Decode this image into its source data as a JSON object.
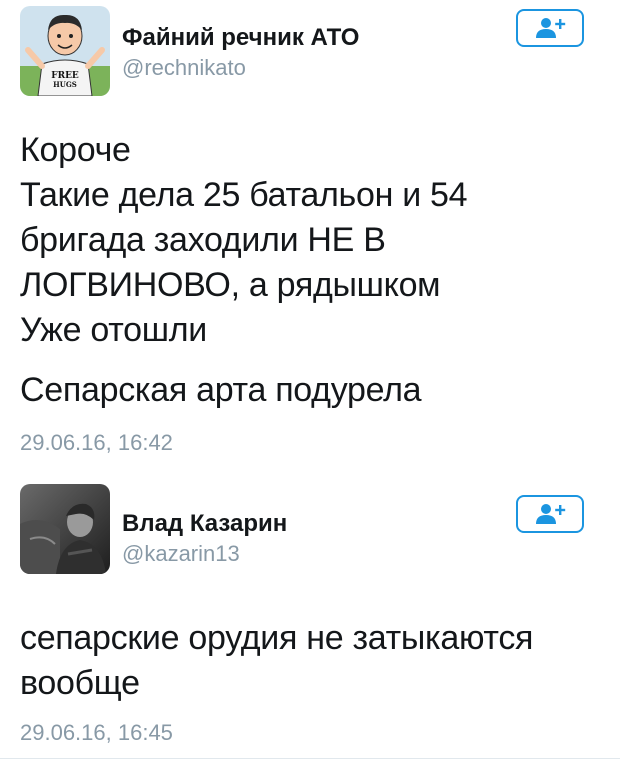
{
  "tweets": [
    {
      "author_name": "Файний речник АТО",
      "handle": "@rechnikato",
      "avatar_text": [
        "FREE",
        "HUGS"
      ],
      "paragraphs": [
        [
          "Короче",
          "Такие дела 25 батальон и 54",
          "бригада заходили НЕ В",
          "ЛОГВИНОВО, а рядышком",
          "Уже отошли"
        ],
        [
          "Сепарская арта подурела"
        ]
      ],
      "timestamp": "29.06.16, 16:42"
    },
    {
      "author_name": "Влад Казарин",
      "handle": "@kazarin13",
      "paragraphs": [
        [
          "сепарские орудия не затыкаются",
          "вообще"
        ]
      ],
      "timestamp": "29.06.16, 16:45"
    }
  ],
  "follow_icon": "add-user-icon",
  "accent_color": "#1b95e0"
}
